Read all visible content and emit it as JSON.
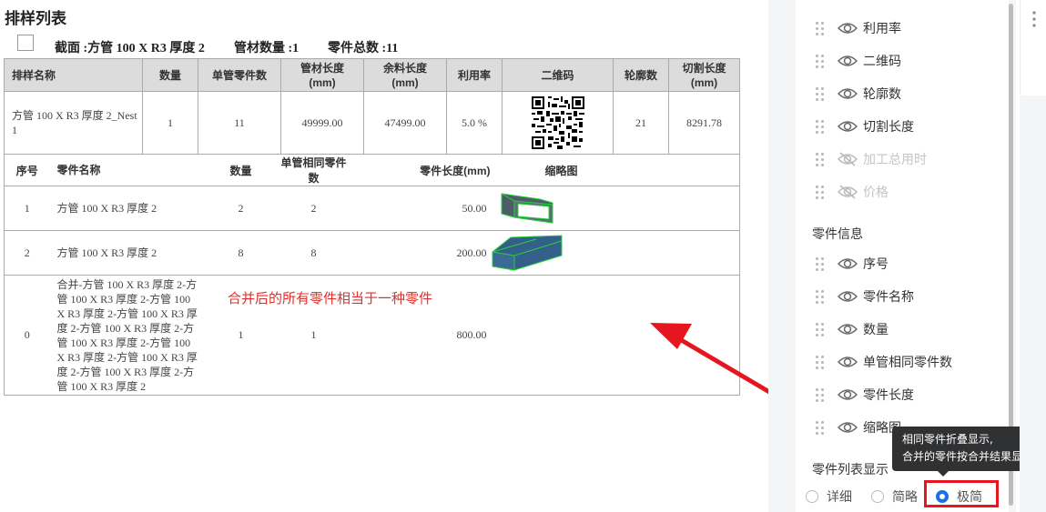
{
  "page_title": "排样列表",
  "summary": {
    "section": "截面 :方管 100 X R3 厚度 2",
    "tube_count": "管材数量 :1",
    "part_total": "零件总数 :11"
  },
  "nest_table": {
    "headers": [
      "排样名称",
      "数量",
      "单管零件数",
      "管材长度\n(mm)",
      "余料长度\n(mm)",
      "利用率",
      "二维码",
      "轮廓数",
      "切割长度\n(mm)"
    ],
    "row": {
      "name": "方管 100 X R3 厚度 2_Nest 1",
      "qty": "1",
      "parts_per_tube": "11",
      "tube_length": "49999.00",
      "remnant_length": "47499.00",
      "utilization": "5.0 %",
      "contours": "21",
      "cut_length": "8291.78"
    }
  },
  "parts_table": {
    "headers": [
      "序号",
      "零件名称",
      "数量",
      "单管相同零件数",
      "零件长度(mm)",
      "缩略图"
    ],
    "rows": [
      {
        "no": "1",
        "name": "方管 100 X R3 厚度 2",
        "qty": "2",
        "same": "2",
        "length": "50.00"
      },
      {
        "no": "2",
        "name": "方管 100 X R3 厚度 2",
        "qty": "8",
        "same": "8",
        "length": "200.00"
      },
      {
        "no": "0",
        "name": "合并-方管 100 X R3 厚度 2-方管 100 X R3 厚度 2-方管 100 X R3 厚度 2-方管 100 X R3 厚度 2-方管 100 X R3 厚度 2-方管 100 X R3 厚度 2-方管 100 X R3 厚度 2-方管 100 X R3 厚度 2-方管 100 X R3 厚度 2-方管 100 X R3 厚度 2",
        "qty": "1",
        "same": "1",
        "length": "800.00"
      }
    ]
  },
  "annotation": "合并后的所有零件相当于一种零件",
  "panel": {
    "top_fields": [
      {
        "label": "利用率",
        "visible": true
      },
      {
        "label": "二维码",
        "visible": true
      },
      {
        "label": "轮廓数",
        "visible": true
      },
      {
        "label": "切割长度",
        "visible": true
      },
      {
        "label": "加工总用时",
        "visible": false
      },
      {
        "label": "价格",
        "visible": false
      }
    ],
    "part_info_title": "零件信息",
    "part_fields": [
      {
        "label": "序号",
        "visible": true
      },
      {
        "label": "零件名称",
        "visible": true
      },
      {
        "label": "数量",
        "visible": true
      },
      {
        "label": "单管相同零件数",
        "visible": true
      },
      {
        "label": "零件长度",
        "visible": true
      },
      {
        "label": "缩略图",
        "visible": true
      }
    ],
    "display_mode_title": "零件列表显示",
    "display_options": [
      "详细",
      "简略",
      "极简"
    ],
    "selected_option": "极简"
  },
  "tooltip": {
    "line1": "相同零件折叠显示,",
    "line2": "合并的零件按合并结果显示"
  },
  "colors": {
    "accent": "#1a6fe8",
    "annotation": "#e0302a",
    "highlight": "#e5161f",
    "header_bg": "#dcdcdc",
    "part_fill": "#3b6591",
    "part_edge": "#27d13a"
  }
}
